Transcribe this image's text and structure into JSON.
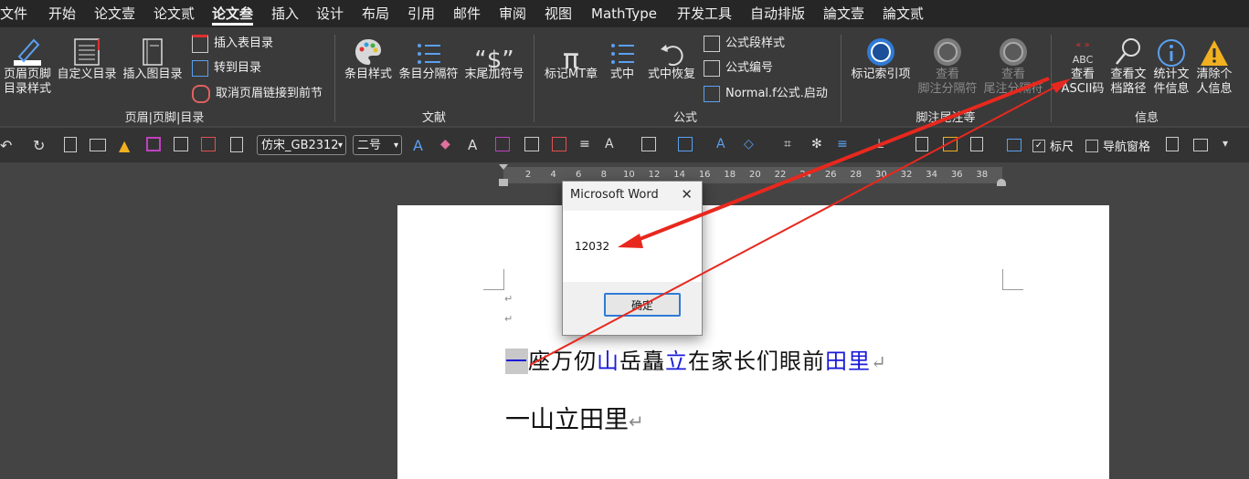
{
  "menu": {
    "tabs": [
      "文件",
      "开始",
      "论文壹",
      "论文贰",
      "论文叁",
      "插入",
      "设计",
      "布局",
      "引用",
      "邮件",
      "审阅",
      "视图",
      "MathType",
      "开发工具",
      "自动排版",
      "論文壹",
      "論文贰"
    ],
    "active_index": 4
  },
  "ribbon": {
    "group1": {
      "buttons": [
        "页眉页脚\n目录样式",
        "自定义目录",
        "插入图目录"
      ],
      "small": [
        "插入表目录",
        "转到目录",
        "取消页眉链接到前节"
      ],
      "label": "页眉|页脚|目录"
    },
    "group2": {
      "buttons": [
        "条目样式",
        "条目分隔符",
        "末尾加符号"
      ],
      "label": "文献"
    },
    "group3": {
      "buttons": [
        "标记MT章",
        "式中",
        "式中恢复"
      ],
      "small": [
        "公式段样式",
        "公式编号",
        "Normal.f公式.启动"
      ],
      "label": "公式"
    },
    "group4": {
      "buttons": [
        "标记索引项",
        "查看\n脚注分隔符",
        "查看\n尾注分隔符"
      ],
      "label": "脚注尾注等"
    },
    "group5": {
      "buttons": [
        "查看\nASCII码",
        "查看文\n档路径",
        "统计文\n件信息",
        "清除个\n人信息"
      ],
      "label": "信息"
    }
  },
  "qat": {
    "font": "仿宋_GB2312",
    "size": "二号",
    "ruler_checkbox": "标尺",
    "nav_checkbox": "导航窗格"
  },
  "ruler": {
    "ticks": [
      "2",
      "4",
      "6",
      "8",
      "10",
      "12",
      "14",
      "16",
      "18",
      "20",
      "22",
      "24",
      "26",
      "28",
      "30",
      "32",
      "34",
      "36",
      "38"
    ]
  },
  "document": {
    "line1": [
      "一",
      "座万仞",
      "山",
      "岳矗",
      "立",
      "在家长们眼前",
      "田里"
    ],
    "line2": "一山立田里"
  },
  "dialog": {
    "title": "Microsoft Word",
    "message": "12032",
    "ok": "确定",
    "close_glyph": "✕"
  },
  "icons": [
    "pen-icon",
    "list-icon",
    "book-icon",
    "palette-icon",
    "pi-icon",
    "target-icon",
    "abc-icon",
    "magnifier-icon",
    "info-icon",
    "warning-icon"
  ],
  "colors": {
    "menubar": "#262626",
    "ribbon": "#3a3a3a",
    "accent_blue": "#2f7bd6",
    "doc_blue": "#1a1ad8",
    "arrow_red": "#e8281e"
  }
}
